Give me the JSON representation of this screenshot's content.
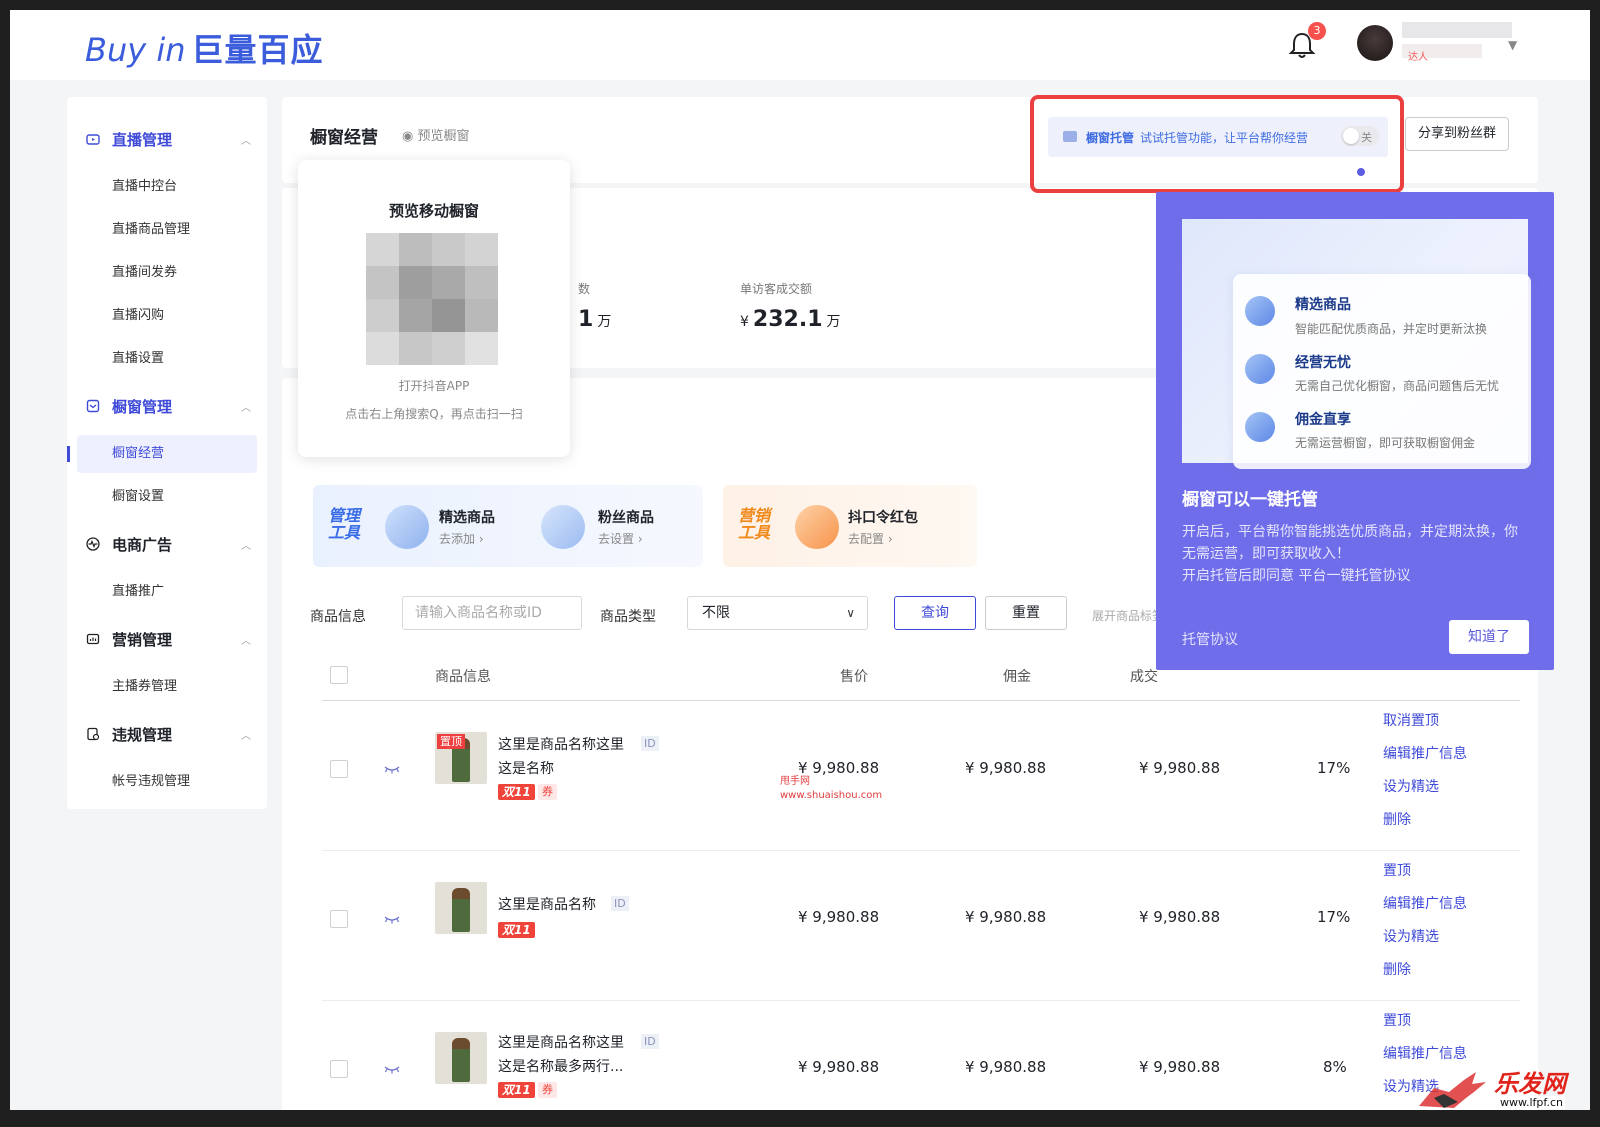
{
  "header": {
    "logo_en": "Buy in",
    "logo_cn": "巨量百应",
    "notification_count": "3",
    "user_tag": "达人"
  },
  "sidebar": {
    "groups": [
      {
        "label": "直播管理",
        "items": [
          "直播中控台",
          "直播商品管理",
          "直播间发券",
          "直播闪购",
          "直播设置"
        ]
      },
      {
        "label": "橱窗管理",
        "items": [
          "橱窗经营",
          "橱窗设置"
        ]
      },
      {
        "label": "电商广告",
        "items": [
          "直播推广"
        ]
      },
      {
        "label": "营销管理",
        "items": [
          "主播券管理"
        ]
      },
      {
        "label": "违规管理",
        "items": [
          "帐号违规管理"
        ]
      }
    ],
    "active_item": "橱窗经营"
  },
  "page": {
    "title": "橱窗经营",
    "preview_link": "预览橱窗",
    "hosting": {
      "label": "橱窗托管",
      "text": "试试托管功能，让平台帮你经营",
      "toggle": "关"
    },
    "share_button": "分享到粉丝群"
  },
  "stats": [
    {
      "label": "数",
      "value": "1",
      "unit": "万"
    },
    {
      "label": "单访客成交额",
      "currency": "¥",
      "value": "232.1",
      "unit": "万"
    }
  ],
  "preview_popup": {
    "title": "预览移动橱窗",
    "line1": "打开抖音APP",
    "line2": "点击右上角搜索Q，再点击扫一扫"
  },
  "tools": [
    {
      "tag": "管理工具",
      "items": [
        {
          "name": "精选商品",
          "sub": "去添加 ›"
        },
        {
          "name": "粉丝商品",
          "sub": "去设置 ›"
        }
      ]
    },
    {
      "tag": "营销工具",
      "items": [
        {
          "name": "抖口令红包",
          "sub": "去配置 ›"
        }
      ]
    }
  ],
  "filter": {
    "product_info_label": "商品信息",
    "product_info_placeholder": "请输入商品名称或ID",
    "product_type_label": "商品类型",
    "product_type_value": "不限",
    "query_button": "查询",
    "reset_button": "重置",
    "expand_link": "展开商品标签"
  },
  "table": {
    "columns": [
      "商品信息",
      "售价",
      "佣金",
      "成交"
    ],
    "rows": [
      {
        "name1": "这里是商品名称这里",
        "name2": "这是名称",
        "id_tag": "ID",
        "pinned": "置顶",
        "tag11": "双11",
        "coupon": "券",
        "price": "¥ 9,980.88",
        "commission": "¥ 9,980.88",
        "sales": "¥ 9,980.88",
        "rate": "17%",
        "ops": [
          "取消置顶",
          "编辑推广信息",
          "设为精选",
          "删除"
        ]
      },
      {
        "name1": "这里是商品名称",
        "name2": "",
        "id_tag": "ID",
        "pinned": "",
        "tag11": "双11",
        "coupon": "",
        "price": "¥ 9,980.88",
        "commission": "¥ 9,980.88",
        "sales": "¥ 9,980.88",
        "rate": "17%",
        "ops": [
          "置顶",
          "编辑推广信息",
          "设为精选",
          "删除"
        ]
      },
      {
        "name1": "这里是商品名称这里",
        "name2": "这是名称最多两行...",
        "id_tag": "ID",
        "pinned": "",
        "tag11": "双11",
        "coupon": "券",
        "price": "¥ 9,980.88",
        "commission": "¥ 9,980.88",
        "sales": "¥ 9,980.88",
        "rate": "8%",
        "ops": [
          "置顶",
          "编辑推广信息",
          "设为精选"
        ]
      }
    ]
  },
  "watermark": {
    "line1": "甩手网",
    "line2": "www.shuaishou.com"
  },
  "promo": {
    "features": [
      {
        "title": "精选商品",
        "desc": "智能匹配优质商品，并定时更新汰换"
      },
      {
        "title": "经营无忧",
        "desc": "无需自己优化橱窗，商品问题售后无忧"
      },
      {
        "title": "佣金直享",
        "desc": "无需运营橱窗，即可获取橱窗佣金"
      }
    ],
    "title": "橱窗可以一键托管",
    "desc": "开启后，平台帮你智能挑选优质商品，并定期汰换，你无需运营，即可获取收入！",
    "desc2": "开启托管后即同意 平台一键托管协议",
    "agreement_link": "托管协议",
    "ok_button": "知道了"
  },
  "corner_watermark": {
    "text": "乐发网",
    "url": "www.lfpf.cn"
  }
}
